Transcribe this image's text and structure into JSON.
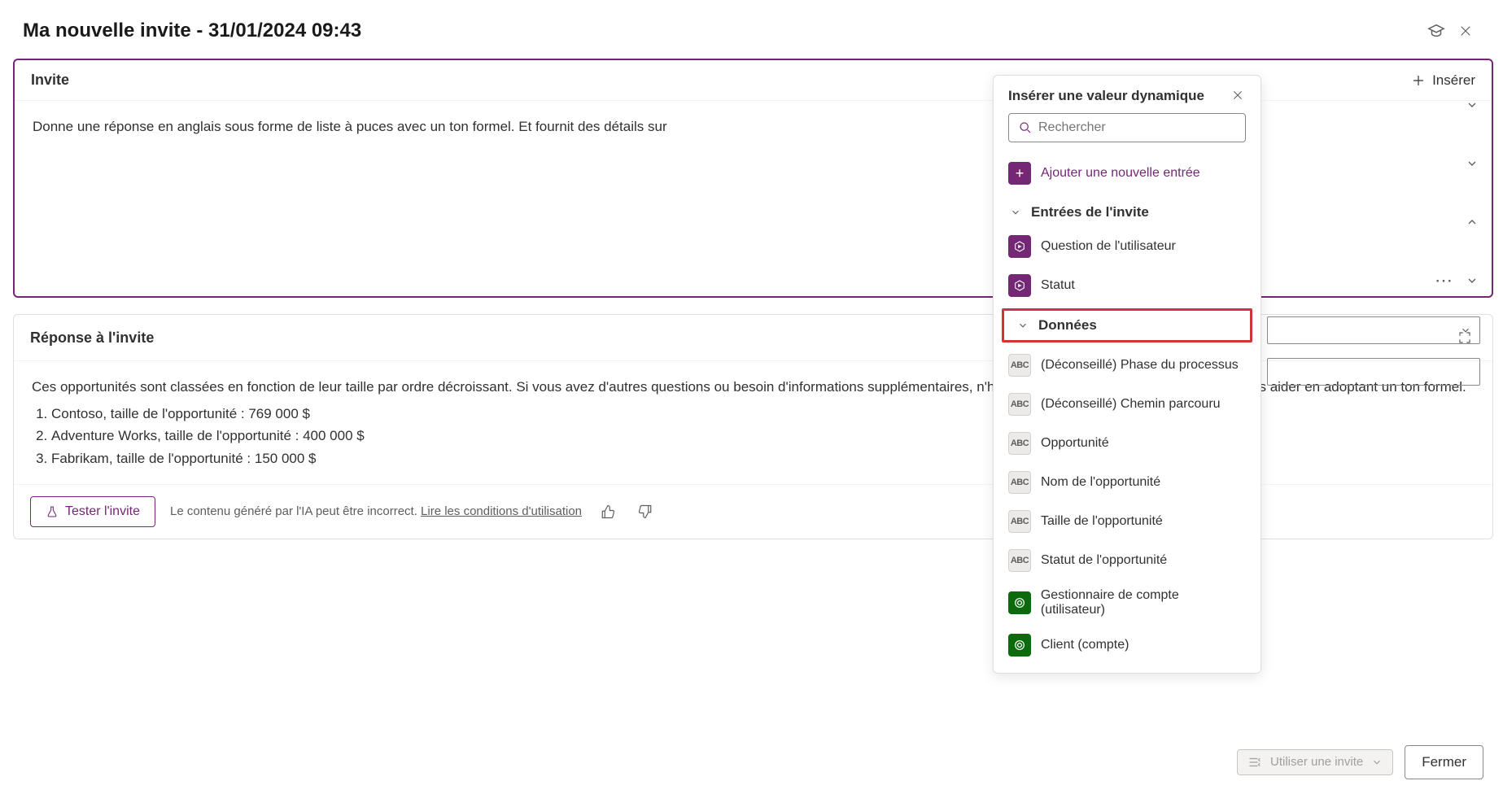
{
  "titlebar": {
    "title": "Ma nouvelle invite - 31/01/2024 09:43"
  },
  "prompt_card": {
    "header": "Invite",
    "insert_label": "Insérer",
    "body": "Donne une réponse en anglais sous forme de liste à puces avec un ton formel. Et fournit des détails sur"
  },
  "response_card": {
    "header": "Réponse à l'invite",
    "intro": "Ces opportunités sont classées en fonction de leur taille par ordre décroissant. Si vous avez d'autres questions ou besoin d'informations supplémentaires, n'hésitez pas à demander. Je suis ici pour vous aider en adoptant un ton formel.",
    "items": [
      "Contoso, taille de l'opportunité : 769 000 $",
      "Adventure Works, taille de l'opportunité : 400 000 $",
      "Fabrikam, taille de l'opportunité : 150 000 $"
    ],
    "test_label": "Tester l'invite",
    "disclaimer_text": "Le contenu généré par l'IA peut être incorrect. ",
    "disclaimer_link": "Lire les conditions d'utilisation"
  },
  "dynamic_panel": {
    "title": "Insérer une valeur dynamique",
    "search_placeholder": "Rechercher",
    "add_label": "Ajouter une nouvelle entrée",
    "sections": {
      "inputs_header": "Entrées de l'invite",
      "inputs": [
        {
          "label": "Question de l'utilisateur"
        },
        {
          "label": "Statut"
        }
      ],
      "data_header": "Données",
      "data": [
        {
          "label": "(Déconseillé) Phase du processus",
          "kind": "grey"
        },
        {
          "label": "(Déconseillé) Chemin parcouru",
          "kind": "grey"
        },
        {
          "label": "Opportunité",
          "kind": "grey"
        },
        {
          "label": "Nom de l'opportunité",
          "kind": "grey"
        },
        {
          "label": "Taille de l'opportunité",
          "kind": "grey"
        },
        {
          "label": "Statut de l'opportunité",
          "kind": "grey"
        },
        {
          "label": "Gestionnaire de compte (utilisateur)",
          "kind": "green"
        },
        {
          "label": "Client (compte)",
          "kind": "green"
        }
      ]
    }
  },
  "footer": {
    "use_label": "Utiliser une invite",
    "close_label": "Fermer"
  }
}
